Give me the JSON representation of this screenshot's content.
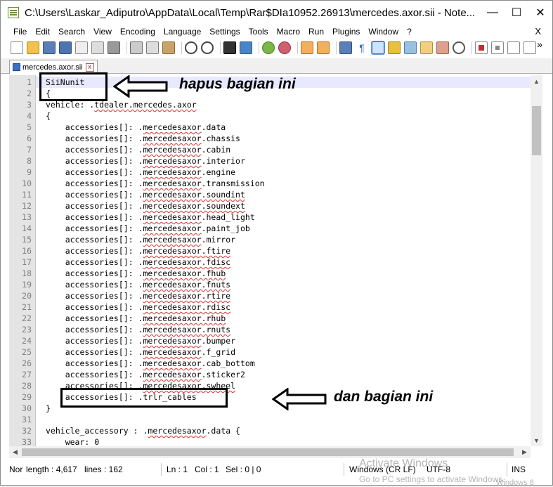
{
  "window": {
    "title": "C:\\Users\\Laskar_Adiputro\\AppData\\Local\\Temp\\Rar$DIa10952.26913\\mercedes.axor.sii - Note...",
    "min": "—",
    "max": "☐",
    "close": "✕"
  },
  "menu": {
    "items": [
      "File",
      "Edit",
      "Search",
      "View",
      "Encoding",
      "Language",
      "Settings",
      "Tools",
      "Macro",
      "Run",
      "Plugins",
      "Window",
      "?"
    ],
    "close": "X"
  },
  "toolbar": {
    "more": "»"
  },
  "tab": {
    "label": "mercedes.axor.sii",
    "close": "x"
  },
  "editor": {
    "line_numbers": [
      "1",
      "2",
      "3",
      "4",
      "5",
      "6",
      "7",
      "8",
      "9",
      "10",
      "11",
      "12",
      "13",
      "14",
      "15",
      "16",
      "17",
      "18",
      "19",
      "20",
      "21",
      "22",
      "23",
      "24",
      "25",
      "26",
      "27",
      "28",
      "29",
      "30",
      "31",
      "32",
      "33"
    ],
    "lines": [
      {
        "pre": "SiiNunit",
        "sq": "",
        "post": ""
      },
      {
        "pre": "{",
        "sq": "",
        "post": ""
      },
      {
        "pre": "vehicle: .",
        "sq": "tdealer.mercedes.axor",
        "post": ""
      },
      {
        "pre": "{",
        "sq": "",
        "post": ""
      },
      {
        "pre": "    accessories[]: .",
        "sq": "mercedesaxor",
        "post": ".data"
      },
      {
        "pre": "    accessories[]: .",
        "sq": "mercedesaxor",
        "post": ".chassis"
      },
      {
        "pre": "    accessories[]: .",
        "sq": "mercedesaxor",
        "post": ".cabin"
      },
      {
        "pre": "    accessories[]: .",
        "sq": "mercedesaxor",
        "post": ".interior"
      },
      {
        "pre": "    accessories[]: .",
        "sq": "mercedesaxor",
        "post": ".engine"
      },
      {
        "pre": "    accessories[]: .",
        "sq": "mercedesaxor",
        "post": ".transmission"
      },
      {
        "pre": "    accessories[]: .",
        "sq": "mercedesaxor.soundint",
        "post": ""
      },
      {
        "pre": "    accessories[]: .",
        "sq": "mercedesaxor.soundext",
        "post": ""
      },
      {
        "pre": "    accessories[]: .",
        "sq": "mercedesaxor",
        "post": ".head_light"
      },
      {
        "pre": "    accessories[]: .",
        "sq": "mercedesaxor",
        "post": ".paint_job"
      },
      {
        "pre": "    accessories[]: .",
        "sq": "mercedesaxor",
        "post": ".mirror"
      },
      {
        "pre": "    accessories[]: .",
        "sq": "mercedesaxor.ftire",
        "post": ""
      },
      {
        "pre": "    accessories[]: .",
        "sq": "mercedesaxor.fdisc",
        "post": ""
      },
      {
        "pre": "    accessories[]: .",
        "sq": "mercedesaxor.fhub",
        "post": ""
      },
      {
        "pre": "    accessories[]: .",
        "sq": "mercedesaxor.fnuts",
        "post": ""
      },
      {
        "pre": "    accessories[]: .",
        "sq": "mercedesaxor.rtire",
        "post": ""
      },
      {
        "pre": "    accessories[]: .",
        "sq": "mercedesaxor.rdisc",
        "post": ""
      },
      {
        "pre": "    accessories[]: .",
        "sq": "mercedesaxor.rhub",
        "post": ""
      },
      {
        "pre": "    accessories[]: .",
        "sq": "mercedesaxor.rnuts",
        "post": ""
      },
      {
        "pre": "    accessories[]: .",
        "sq": "mercedesaxor",
        "post": ".bumper"
      },
      {
        "pre": "    accessories[]: .",
        "sq": "mercedesaxor",
        "post": ".f_grid"
      },
      {
        "pre": "    accessories[]: .",
        "sq": "mercedesaxor",
        "post": ".cab_bottom"
      },
      {
        "pre": "    accessories[]: .",
        "sq": "mercedesaxor",
        "post": ".sticker2"
      },
      {
        "pre": "    accessories[]: .",
        "sq": "mercedesaxor.swheel",
        "post": ""
      },
      {
        "pre": "    accessories[]: .trlr_cables",
        "sq": "",
        "post": ""
      },
      {
        "pre": "}",
        "sq": "",
        "post": ""
      },
      {
        "pre": "",
        "sq": "",
        "post": ""
      },
      {
        "pre": "vehicle_accessory : .",
        "sq": "mercedesaxor",
        "post": ".data {"
      },
      {
        "pre": "    wear: 0",
        "sq": "",
        "post": ""
      }
    ]
  },
  "annotations": {
    "top": "hapus bagian ini",
    "bottom": "dan bagian ini"
  },
  "status": {
    "type": "Nor",
    "length": "length : 4,617",
    "lines": "lines : 162",
    "ln": "Ln : 1",
    "col": "Col : 1",
    "sel": "Sel : 0 | 0",
    "eol": "Windows (CR LF)",
    "encoding": "UTF-8",
    "mode": "INS"
  },
  "watermark": {
    "line1": "Activate Windows",
    "line2": "Go to PC settings to activate Windows.",
    "line3": "Windows 8"
  }
}
